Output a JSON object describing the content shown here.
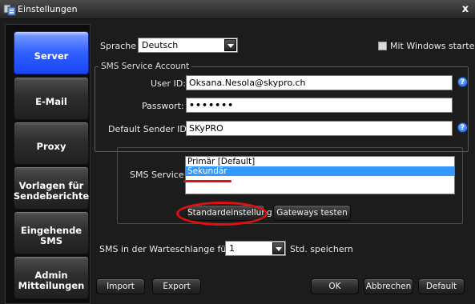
{
  "window": {
    "title": "Einstellungen",
    "close_glyph": "x",
    "icon": "settings-app-icon"
  },
  "sidebar": {
    "items": [
      {
        "label": "Server",
        "active": true
      },
      {
        "label": "E-Mail",
        "active": false
      },
      {
        "label": "Proxy",
        "active": false
      },
      {
        "label": "Vorlagen für Sendeberichte",
        "active": false
      },
      {
        "label": "Eingehende SMS",
        "active": false
      },
      {
        "label": "Admin Mitteilungen",
        "active": false
      }
    ]
  },
  "server": {
    "language_label": "Sprache",
    "language_value": "Deutsch",
    "autostart_label": "Mit Windows starten",
    "account_group_title": "SMS Service Account",
    "user_id_label": "User ID:",
    "user_id_value": "Oksana.Nesola@skypro.ch",
    "password_label": "Passwort:",
    "password_value": "•••••••",
    "sender_id_label": "Default Sender ID:",
    "sender_id_value": "SKyPRO",
    "help_glyph": "?",
    "sms_service_label": "SMS Service:",
    "sms_service_options": [
      {
        "label": "Primär [Default]",
        "selected": false
      },
      {
        "label": "Sekundär",
        "selected": true
      }
    ],
    "default_setting_button": "Standardeinstellung",
    "test_gateways_button": "Gateways testen",
    "queue_label": "SMS in der Warteschlange für",
    "queue_value": "1",
    "queue_suffix": "Std. speichern"
  },
  "footer": {
    "import_button": "Import",
    "export_button": "Export",
    "ok_button": "OK",
    "cancel_button": "Abbrechen",
    "default_button": "Default"
  },
  "colors": {
    "active_nav": "#2f5fff",
    "annotation": "#e01010",
    "selection": "#3399ff"
  }
}
